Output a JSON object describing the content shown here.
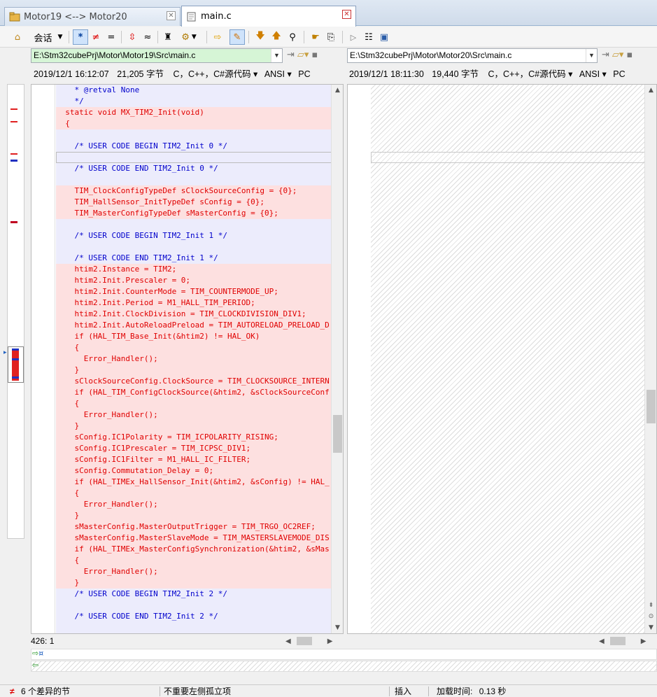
{
  "tabs": [
    {
      "label": "Motor19 <--> Motor20",
      "active": false
    },
    {
      "label": "main.c",
      "active": true
    }
  ],
  "toolbar": {
    "session_label": "会话",
    "icons": [
      "home-icon",
      "session-dropdown",
      "show-all-icon",
      "show-diff-icon",
      "show-same-icon",
      "diff-context-icon",
      "ignore-unimportant-icon",
      "rules-icon",
      "format-icon",
      "swap-icon",
      "edit-icon",
      "next-diff-icon",
      "prev-diff-icon",
      "find-icon",
      "bookmark-icon",
      "copy-icon",
      "file-icon",
      "align-icon",
      "export-icon"
    ]
  },
  "left": {
    "path": "E:\\Stm32cubePrj\\Motor\\Motor19\\Src\\main.c",
    "datetime": "2019/12/1 16:12:07",
    "size": "21,205 字节",
    "lang": "C，C++，C#源代码",
    "encoding": "ANSI",
    "lineend": "PC",
    "position": "426: 1"
  },
  "right": {
    "path": "E:\\Stm32cubePrj\\Motor\\Motor20\\Src\\main.c",
    "datetime": "2019/12/1 18:11:30",
    "size": "19,440 字节",
    "lang": "C，C++，C#源代码",
    "encoding": "ANSI",
    "lineend": "PC"
  },
  "code_lines": [
    {
      "text": "    * @retval None",
      "kind": "ctx"
    },
    {
      "text": "    */",
      "kind": "ctx"
    },
    {
      "text": "  static void MX_TIM2_Init(void)",
      "kind": "diff"
    },
    {
      "text": "  {",
      "kind": "diff"
    },
    {
      "text": "",
      "kind": "ctx"
    },
    {
      "text": "    /* USER CODE BEGIN TIM2_Init 0 */",
      "kind": "ctx"
    },
    {
      "text": "",
      "kind": "cursor"
    },
    {
      "text": "    /* USER CODE END TIM2_Init 0 */",
      "kind": "ctx"
    },
    {
      "text": "",
      "kind": "ctx"
    },
    {
      "text": "    TIM_ClockConfigTypeDef sClockSourceConfig = {0};",
      "kind": "diff"
    },
    {
      "text": "    TIM_HallSensor_InitTypeDef sConfig = {0};",
      "kind": "diff"
    },
    {
      "text": "    TIM_MasterConfigTypeDef sMasterConfig = {0};",
      "kind": "diff"
    },
    {
      "text": "",
      "kind": "ctx"
    },
    {
      "text": "    /* USER CODE BEGIN TIM2_Init 1 */",
      "kind": "ctx"
    },
    {
      "text": "",
      "kind": "ctx"
    },
    {
      "text": "    /* USER CODE END TIM2_Init 1 */",
      "kind": "ctx"
    },
    {
      "text": "    htim2.Instance = TIM2;",
      "kind": "diff"
    },
    {
      "text": "    htim2.Init.Prescaler = 0;",
      "kind": "diff"
    },
    {
      "text": "    htim2.Init.CounterMode = TIM_COUNTERMODE_UP;",
      "kind": "diff"
    },
    {
      "text": "    htim2.Init.Period = M1_HALL_TIM_PERIOD;",
      "kind": "diff"
    },
    {
      "text": "    htim2.Init.ClockDivision = TIM_CLOCKDIVISION_DIV1;",
      "kind": "diff"
    },
    {
      "text": "    htim2.Init.AutoReloadPreload = TIM_AUTORELOAD_PRELOAD_D",
      "kind": "diff"
    },
    {
      "text": "    if (HAL_TIM_Base_Init(&htim2) != HAL_OK)",
      "kind": "diff"
    },
    {
      "text": "    {",
      "kind": "diff"
    },
    {
      "text": "      Error_Handler();",
      "kind": "diff"
    },
    {
      "text": "    }",
      "kind": "diff"
    },
    {
      "text": "    sClockSourceConfig.ClockSource = TIM_CLOCKSOURCE_INTERN",
      "kind": "diff"
    },
    {
      "text": "    if (HAL_TIM_ConfigClockSource(&htim2, &sClockSourceConf",
      "kind": "diff"
    },
    {
      "text": "    {",
      "kind": "diff"
    },
    {
      "text": "      Error_Handler();",
      "kind": "diff"
    },
    {
      "text": "    }",
      "kind": "diff"
    },
    {
      "text": "    sConfig.IC1Polarity = TIM_ICPOLARITY_RISING;",
      "kind": "diff"
    },
    {
      "text": "    sConfig.IC1Prescaler = TIM_ICPSC_DIV1;",
      "kind": "diff"
    },
    {
      "text": "    sConfig.IC1Filter = M1_HALL_IC_FILTER;",
      "kind": "diff"
    },
    {
      "text": "    sConfig.Commutation_Delay = 0;",
      "kind": "diff"
    },
    {
      "text": "    if (HAL_TIMEx_HallSensor_Init(&htim2, &sConfig) != HAL_",
      "kind": "diff"
    },
    {
      "text": "    {",
      "kind": "diff"
    },
    {
      "text": "      Error_Handler();",
      "kind": "diff"
    },
    {
      "text": "    }",
      "kind": "diff"
    },
    {
      "text": "    sMasterConfig.MasterOutputTrigger = TIM_TRGO_OC2REF;",
      "kind": "diff"
    },
    {
      "text": "    sMasterConfig.MasterSlaveMode = TIM_MASTERSLAVEMODE_DIS",
      "kind": "diff"
    },
    {
      "text": "    if (HAL_TIMEx_MasterConfigSynchronization(&htim2, &sMas",
      "kind": "diff"
    },
    {
      "text": "    {",
      "kind": "diff"
    },
    {
      "text": "      Error_Handler();",
      "kind": "diff"
    },
    {
      "text": "    }",
      "kind": "diff"
    },
    {
      "text": "    /* USER CODE BEGIN TIM2_Init 2 */",
      "kind": "ctx"
    },
    {
      "text": "",
      "kind": "ctx"
    },
    {
      "text": "    /* USER CODE END TIM2_Init 2 */",
      "kind": "ctx"
    },
    {
      "text": "",
      "kind": "ctx"
    }
  ],
  "status": {
    "diff_count": "6 个差异的节",
    "unimportant": "不重要左侧孤立项",
    "mode": "插入",
    "load_time_label": "加载时间:",
    "load_time_value": "0.13 秒"
  },
  "colors": {
    "diff_bg": "#fde0e0",
    "diff_text": "#e00000",
    "context_text": "#0000cc",
    "left_path_bg": "#d6f5d6"
  }
}
